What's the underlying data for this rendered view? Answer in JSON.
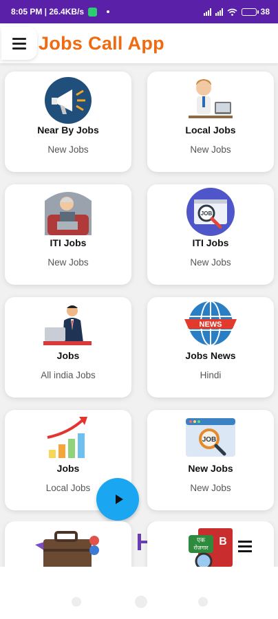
{
  "status_bar": {
    "time_and_speed": "8:05 PM | 26.4KB/s",
    "battery": "38"
  },
  "app_bar": {
    "title": "Jobs Call App"
  },
  "cards": [
    {
      "title": "Near By Jobs",
      "subtitle": "New Jobs",
      "icon": "megaphone-icon"
    },
    {
      "title": "Local Jobs",
      "subtitle": "New Jobs",
      "icon": "office-worker-icon"
    },
    {
      "title": "ITI Jobs",
      "subtitle": "New Jobs",
      "icon": "laptop-worker-icon"
    },
    {
      "title": "ITI Jobs",
      "subtitle": "New Jobs",
      "icon": "job-search-icon"
    },
    {
      "title": "Jobs",
      "subtitle": "All india Jobs",
      "icon": "businessman-laptop-icon"
    },
    {
      "title": "Jobs News",
      "subtitle": "Hindi",
      "icon": "globe-news-icon"
    },
    {
      "title": "Jobs",
      "subtitle": "Local Jobs",
      "icon": "growth-chart-icon"
    },
    {
      "title": "New Jobs",
      "subtitle": "New Jobs",
      "icon": "job-magnifier-icon"
    }
  ],
  "colors": {
    "status_bar": "#5a21a8",
    "title": "#ef6a10",
    "fab": "#1aa6f0"
  },
  "bottom_partial": {
    "book_text_top": "एक",
    "book_text_bottom": "रोज़गार",
    "book_letter": "B"
  }
}
